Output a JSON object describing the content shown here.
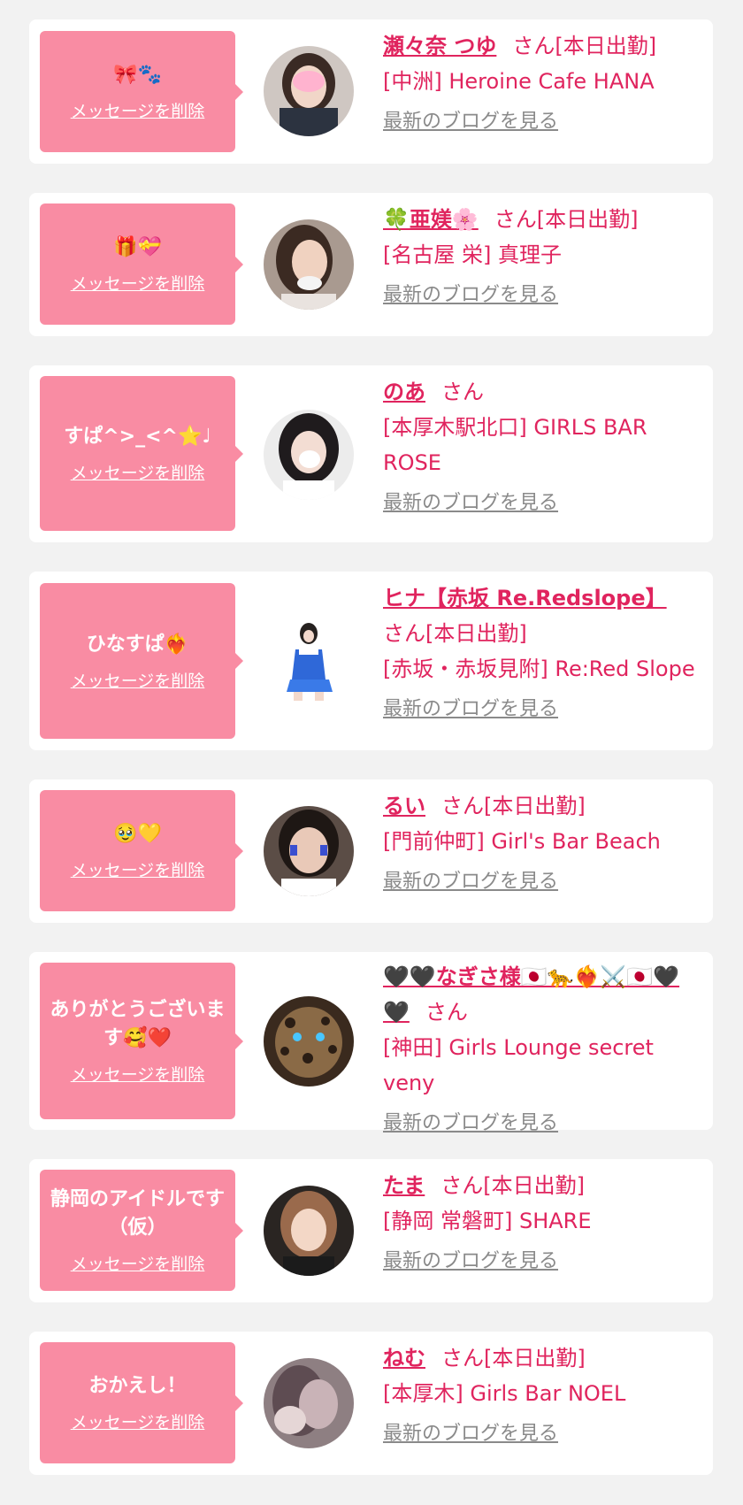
{
  "delete_label": "メッセージを削除",
  "blog_label": "最新のブログを見る",
  "colors": {
    "accent": "#e0245e",
    "bubble": "#f98ca3",
    "background": "#f2f2f2",
    "card": "#ffffff",
    "link_gray": "#8a8a8a"
  },
  "items": [
    {
      "message": "🎀🐾",
      "name": "瀬々奈 つゆ",
      "suffix": "さん[本日出勤]",
      "shop": "[中洲] Heroine Cafe HANA"
    },
    {
      "message": "🎁💝",
      "name": "🍀亜媄🌸",
      "suffix": "さん[本日出勤]",
      "shop": "[名古屋 栄] 真理子"
    },
    {
      "message": "すぱ^>_<^⭐♩",
      "name": "のあ",
      "suffix": "さん",
      "shop": "[本厚木駅北口] GIRLS BAR ROSE"
    },
    {
      "message": "ひなすぱ❤️‍🔥",
      "name": "ヒナ【赤坂 Re.Redslope】",
      "suffix": "さん[本日出勤]",
      "shop": "[赤坂・赤坂見附] Re:Red Slope"
    },
    {
      "message": "🥹💛",
      "name": "るい",
      "suffix": "さん[本日出勤]",
      "shop": "[門前仲町] Girl's Bar Beach"
    },
    {
      "message": "ありがとうございます🥰❤️",
      "name": "🖤🖤なぎさ様🇯🇵🐆❤️‍🔥⚔️🇯🇵🖤🖤",
      "suffix": "さん",
      "shop": "[神田] Girls Lounge secret veny"
    },
    {
      "message": "静岡のアイドルです（仮）",
      "name": "たま",
      "suffix": "さん[本日出勤]",
      "shop": "[静岡 常磐町] SHARE"
    },
    {
      "message": "おかえし！",
      "name": "ねむ",
      "suffix": "さん[本日出勤]",
      "shop": "[本厚木] Girls Bar NOEL"
    }
  ]
}
